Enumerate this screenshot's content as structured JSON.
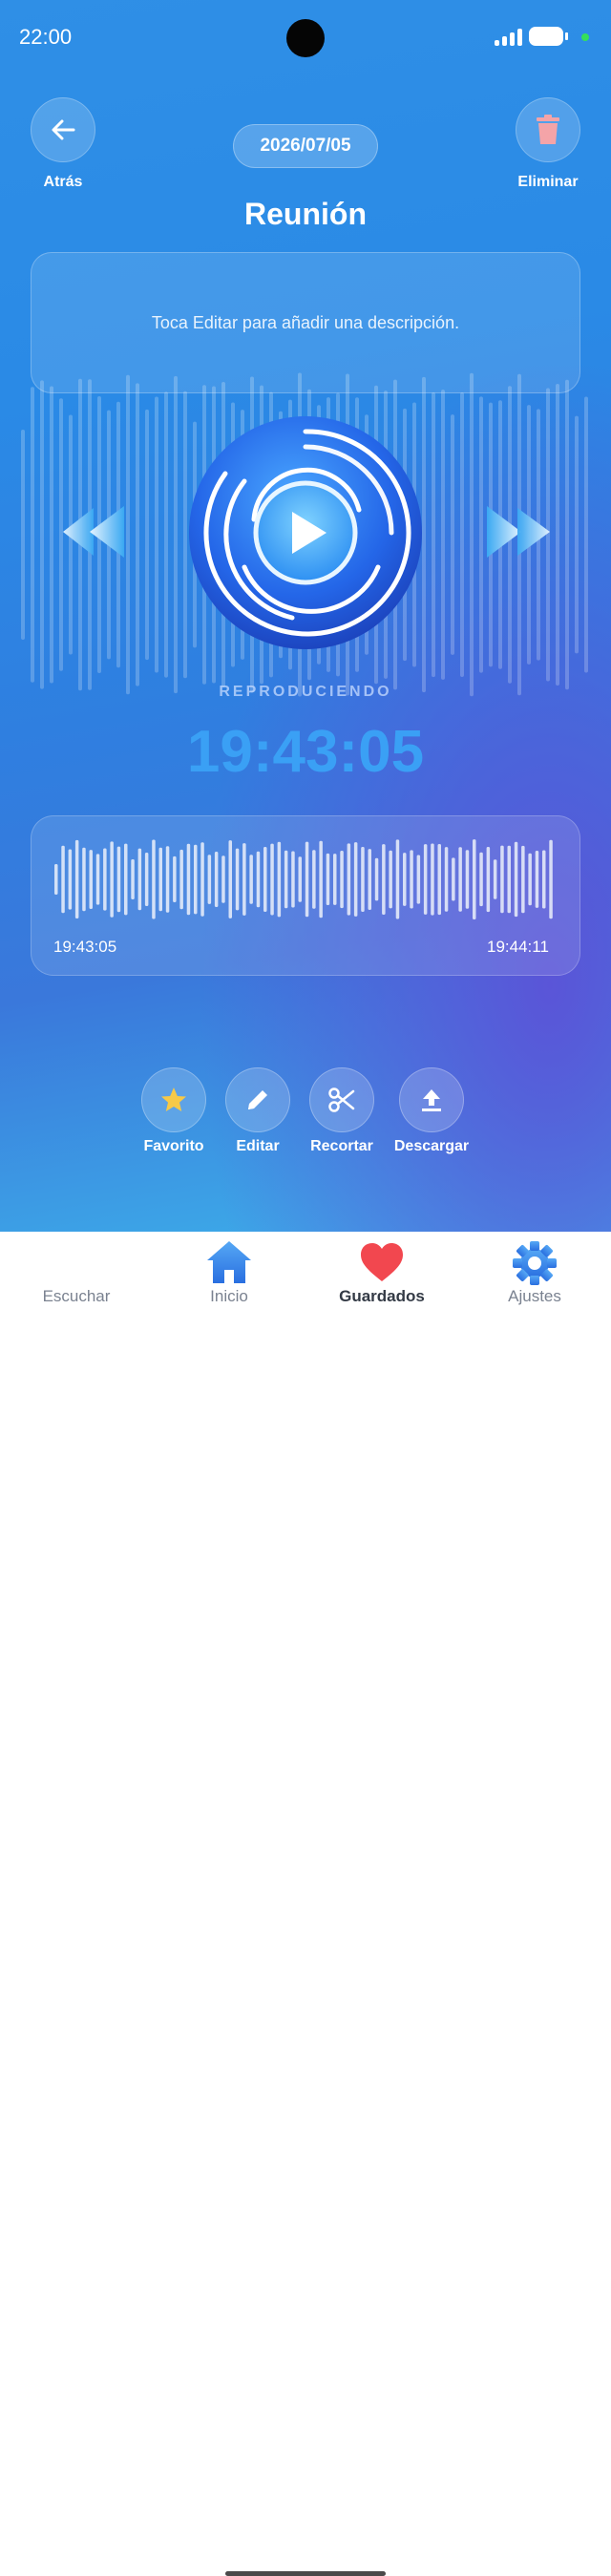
{
  "status_bar": {
    "time": "22:00"
  },
  "header": {
    "back_label": "Atrás",
    "delete_label": "Eliminar",
    "date": "2026/07/05",
    "title": "Reunión"
  },
  "description": {
    "placeholder_text": "Toca Editar para añadir una descripción."
  },
  "player": {
    "state_label": "REPRODUCIENDO",
    "current_time": "19:43:05",
    "play_icon": "play-icon",
    "rewind_icon": "rewind-icon",
    "forward_icon": "fast-forward-icon"
  },
  "waveform": {
    "start_time": "19:43:05",
    "end_time": "19:44:11"
  },
  "actions": [
    {
      "label": "Favorito",
      "icon": "star-icon"
    },
    {
      "label": "Editar",
      "icon": "pencil-icon"
    },
    {
      "label": "Recortar",
      "icon": "scissors-icon"
    },
    {
      "label": "Descargar",
      "icon": "upload-icon"
    }
  ],
  "tabs": [
    {
      "label": "Escuchar",
      "icon": "waveform-icon",
      "active": false
    },
    {
      "label": "Inicio",
      "icon": "home-icon",
      "active": false
    },
    {
      "label": "Guardados",
      "icon": "heart-icon",
      "active": true
    },
    {
      "label": "Ajustes",
      "icon": "gear-icon",
      "active": false
    }
  ],
  "colors": {
    "accent": "#3aa0f5",
    "favorite_star": "#f7c948",
    "delete_icon": "#f4a4a8",
    "heart": "#f2474f",
    "tab_icon_blue": "#2f8fe6"
  }
}
